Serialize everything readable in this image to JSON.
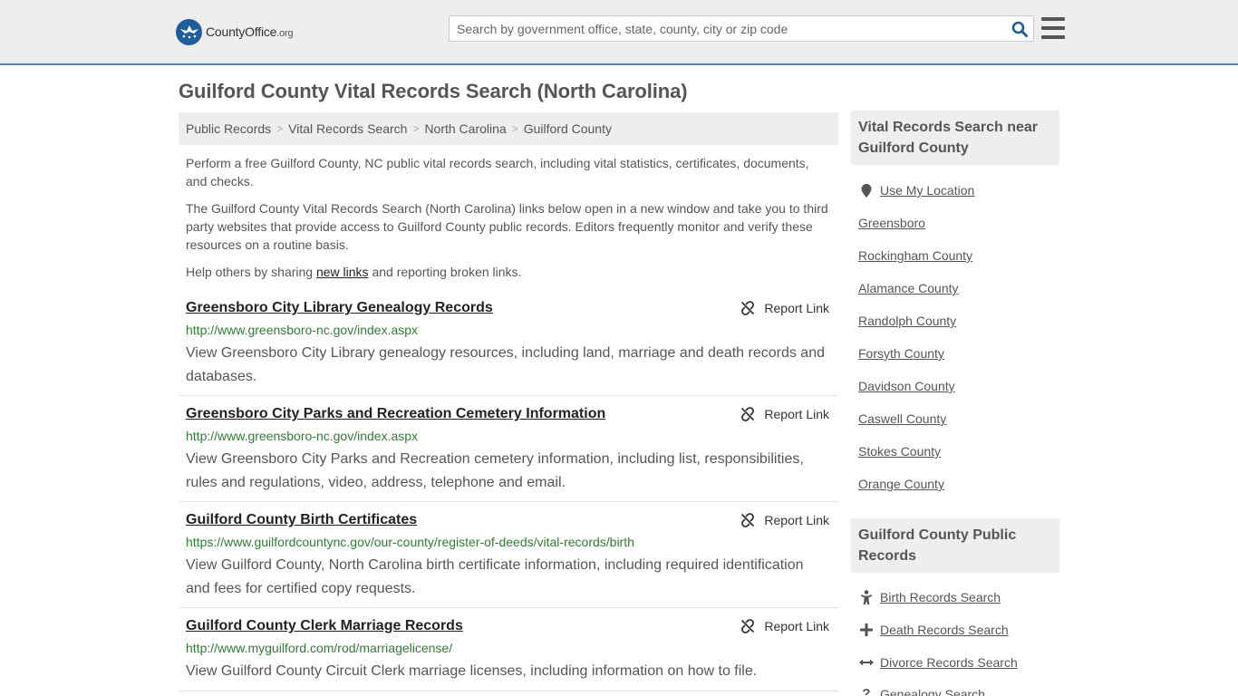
{
  "header": {
    "logo_main": "CountyOffice",
    "logo_tld": ".org",
    "search_placeholder": "Search by government office, state, county, city or zip code"
  },
  "page": {
    "title": "Guilford County Vital Records Search (North Carolina)"
  },
  "breadcrumb": [
    "Public Records",
    "Vital Records Search",
    "North Carolina",
    "Guilford County"
  ],
  "intro": {
    "p1": "Perform a free Guilford County, NC public vital records search, including vital statistics, certificates, documents, and checks.",
    "p2": "The Guilford County Vital Records Search (North Carolina) links below open in a new window and take you to third party websites that provide access to Guilford County public records. Editors frequently monitor and verify these resources on a routine basis.",
    "p3_before": "Help others by sharing",
    "p3_link": "new links",
    "p3_after": "and reporting broken links."
  },
  "report_label": "Report Link",
  "results": [
    {
      "title": "Greensboro City Library Genealogy Records",
      "url": "http://www.greensboro-nc.gov/index.aspx",
      "desc": "View Greensboro City Library genealogy resources, including land, marriage and death records and databases."
    },
    {
      "title": "Greensboro City Parks and Recreation Cemetery Information",
      "url": "http://www.greensboro-nc.gov/index.aspx",
      "desc": "View Greensboro City Parks and Recreation cemetery information, including list, responsibilities, rules and regulations, video, address, telephone and email."
    },
    {
      "title": "Guilford County Birth Certificates",
      "url": "https://www.guilfordcountync.gov/our-county/register-of-deeds/vital-records/birth",
      "desc": "View Guilford County, North Carolina birth certificate information, including required identification and fees for certified copy requests."
    },
    {
      "title": "Guilford County Clerk Marriage Records",
      "url": "http://www.myguilford.com/rod/marriagelicense/",
      "desc": "View Guilford County Circuit Clerk marriage licenses, including information on how to file."
    }
  ],
  "sidebar": {
    "near_heading": "Vital Records Search near Guilford County",
    "use_location": "Use My Location",
    "near_links": [
      "Greensboro",
      "Rockingham County",
      "Alamance County",
      "Randolph County",
      "Forsyth County",
      "Davidson County",
      "Caswell County",
      "Stokes County",
      "Orange County"
    ],
    "public_heading": "Guilford County Public Records",
    "public_links": [
      {
        "label": "Birth Records Search",
        "icon": "child-icon"
      },
      {
        "label": "Death Records Search",
        "icon": "cross-icon"
      },
      {
        "label": "Divorce Records Search",
        "icon": "arrows-horizontal-icon"
      },
      {
        "label": "Genealogy Search",
        "icon": "question-icon"
      }
    ]
  },
  "colors": {
    "brand_blue": "#1f5e9e",
    "header_border": "#4a87c7",
    "url_green": "#2e7d32",
    "panel_gray": "#eeeeee"
  }
}
